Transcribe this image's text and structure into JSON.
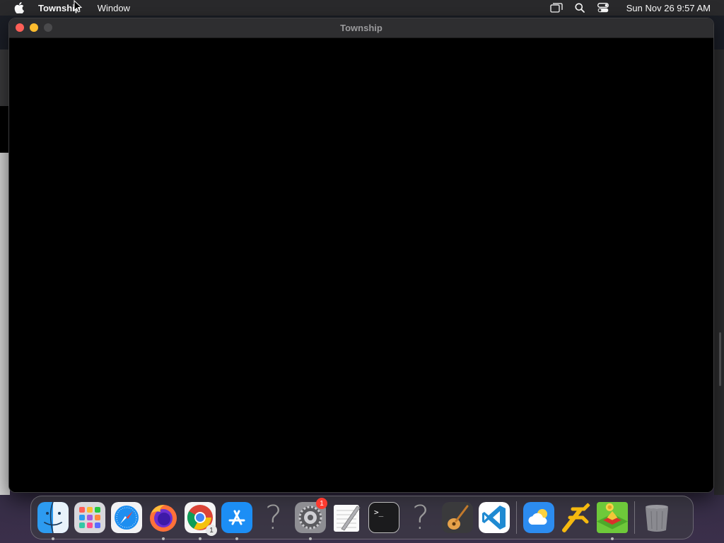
{
  "menubar": {
    "app_name": "Township",
    "menus": [
      "Window"
    ],
    "clock": "Sun Nov 26  9:57 AM",
    "status_icons": [
      "screen-mirroring-icon",
      "search-icon",
      "control-center-icon"
    ]
  },
  "window": {
    "title": "Township"
  },
  "dock": {
    "items": [
      {
        "name": "Finder",
        "icon": "finder-icon",
        "running": true
      },
      {
        "name": "Launchpad",
        "icon": "launchpad-icon",
        "running": false
      },
      {
        "name": "Safari",
        "icon": "safari-icon",
        "running": false
      },
      {
        "name": "Firefox",
        "icon": "firefox-icon",
        "running": true
      },
      {
        "name": "Google Chrome",
        "icon": "chrome-icon",
        "running": true,
        "badge": "1"
      },
      {
        "name": "App Store",
        "icon": "app-store-icon",
        "running": true
      },
      {
        "name": "Unknown App",
        "icon": "question-mark-icon",
        "running": false
      },
      {
        "name": "System Settings",
        "icon": "system-settings-icon",
        "running": true,
        "badge": "1"
      },
      {
        "name": "TextEdit",
        "icon": "textedit-icon",
        "running": false
      },
      {
        "name": "Terminal",
        "icon": "terminal-icon",
        "running": false
      },
      {
        "name": "Unknown App",
        "icon": "question-mark-icon",
        "running": false
      },
      {
        "name": "GarageBand",
        "icon": "garageband-icon",
        "running": false
      },
      {
        "name": "Visual Studio Code",
        "icon": "vscode-icon",
        "running": false
      },
      {
        "name": "Weather",
        "icon": "weather-icon",
        "running": false
      },
      {
        "name": "Direction App",
        "icon": "direction-sign-icon",
        "running": false
      },
      {
        "name": "Township",
        "icon": "township-icon",
        "running": true
      },
      {
        "name": "Trash",
        "icon": "trash-icon",
        "running": false
      }
    ],
    "chrome_badge": "1",
    "settings_badge": "1",
    "terminal_prompt": ">_",
    "question_glyph": "?"
  },
  "colors": {
    "close": "#ff5f57",
    "minimize": "#febc2e",
    "badge": "#ff3b30",
    "window_content": "#000000"
  }
}
